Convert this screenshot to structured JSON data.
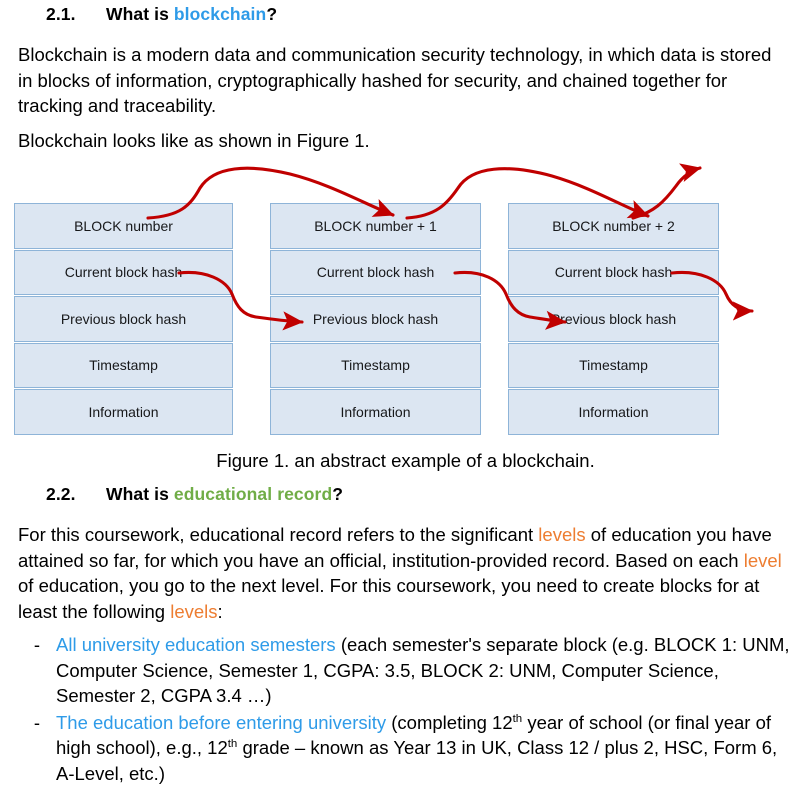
{
  "section_21": {
    "number": "2.1.",
    "prefix": "What is ",
    "keyword": "blockchain",
    "suffix": "?"
  },
  "paragraph_1": "Blockchain is a modern data and communication security technology, in which data is stored in blocks of information, cryptographically hashed for security, and chained together for tracking and traceability.",
  "paragraph_2": "Blockchain looks like as shown in Figure 1.",
  "figure": {
    "caption": "Figure 1. an abstract example of a blockchain.",
    "block_fill": "#dce6f2",
    "block_border": "#8eb4d8",
    "arrow_color": "#c00000",
    "blocks": [
      {
        "title": "BLOCK number",
        "rows": [
          "BLOCK number",
          "Current block hash",
          "Previous block hash",
          "Timestamp",
          "Information"
        ]
      },
      {
        "title": "BLOCK number + 1",
        "rows": [
          "BLOCK number + 1",
          "Current block hash",
          "Previous block hash",
          "Timestamp",
          "Information"
        ]
      },
      {
        "title": "BLOCK number + 2",
        "rows": [
          "BLOCK number + 2",
          "Current block hash",
          "Previous block hash",
          "Timestamp",
          "Information"
        ]
      }
    ]
  },
  "section_22": {
    "number": "2.2.",
    "prefix": "What is ",
    "keyword": "educational record",
    "suffix": "?"
  },
  "paragraph_3": {
    "p1": "For this coursework, educational record refers to the significant ",
    "h1": "levels",
    "p2": " of education you have attained so far, for which you have an official, institution-provided record. Based on each ",
    "h2": "level",
    "p3": " of education, you go to the next level. For this coursework, you need to create blocks for at least the following ",
    "h3": "levels",
    "p4": ":"
  },
  "bullets": {
    "marker": "-",
    "items": [
      {
        "link": "All university education semesters",
        "rest_a": " (each semester's separate block (e.g. BLOCK 1: UNM, Computer Science, Semester 1, CGPA: 3.5, BLOCK 2: UNM, Computer Science, Semester 2, CGPA 3.4 …)"
      },
      {
        "link": "The education before entering university",
        "rest_a": " (completing 12",
        "sup_a": "th",
        "rest_b": " year of school (or final year of high school), e.g., 12",
        "sup_b": "th",
        "rest_c": " grade – known as Year 13 in UK, Class 12 / plus 2, HSC, Form 6, A-Level, etc.)"
      }
    ]
  },
  "colors": {
    "accent_blue": "#2e9be8",
    "accent_green": "#70ad47",
    "accent_orange": "#ed7d31",
    "arrow_red": "#c00000"
  }
}
